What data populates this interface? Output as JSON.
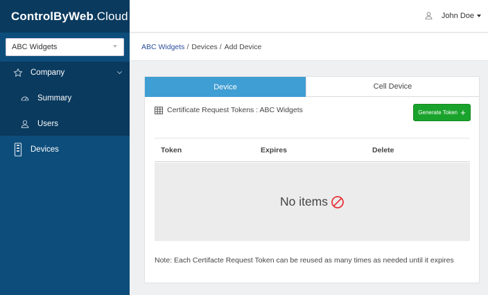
{
  "brand": {
    "bold": "ControlByWeb",
    "light": ".Cloud"
  },
  "org_select": {
    "value": "ABC Widgets"
  },
  "sidebar": {
    "items": [
      {
        "label": "Company",
        "icon": "star-icon"
      },
      {
        "label": "Summary",
        "icon": "gauge-icon"
      },
      {
        "label": "Users",
        "icon": "user-icon"
      },
      {
        "label": "Devices",
        "icon": "device-icon"
      }
    ]
  },
  "header": {
    "user_name": "John Doe"
  },
  "breadcrumb": {
    "org": "ABC Widgets",
    "devices": "Devices",
    "current": "Add Device",
    "separator": "/"
  },
  "tabs": [
    {
      "label": "Device",
      "active": true
    },
    {
      "label": "Cell Device",
      "active": false
    }
  ],
  "panel": {
    "title": "Certificate Request Tokens : ABC Widgets",
    "generate_label": "Generate Token",
    "generate_plus": "+"
  },
  "table": {
    "columns": [
      "Token",
      "Expires",
      "Delete"
    ],
    "empty_text": "No items"
  },
  "note": "Note: Each Certifacte Request Token can be reused as many times as needed until it expires",
  "colors": {
    "sidebar": "#0d4d7b",
    "sidebar_dark": "#0a3a5e",
    "tab_active": "#3f9ed3",
    "button_green": "#1aa32c",
    "no_items_red": "#e8343a",
    "link_blue": "#2a4e9a"
  }
}
